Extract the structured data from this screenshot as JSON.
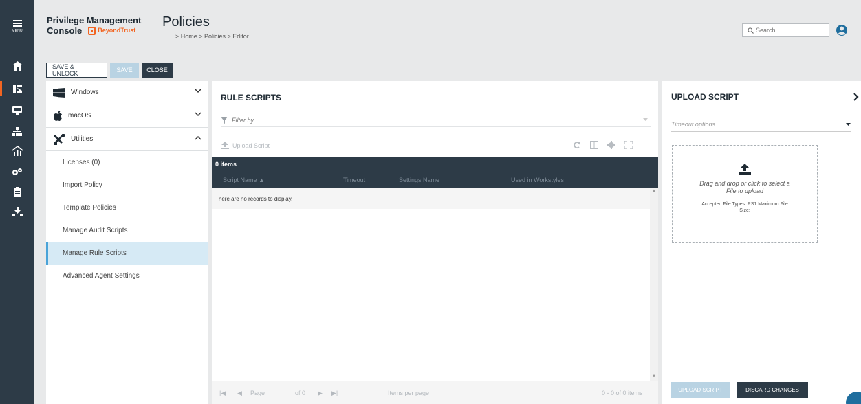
{
  "nav": {
    "menu_label": "MENU",
    "icons": [
      "home-icon",
      "policy-icon",
      "computers-icon",
      "hierarchy-icon",
      "analytics-icon",
      "settings-icon",
      "clipboard-icon",
      "download-icon"
    ],
    "active_index": 1
  },
  "header": {
    "product_line1": "Privilege Management",
    "product_line2": "Console",
    "brand": "BeyondTrust",
    "title": "Policies",
    "breadcrumb": "> Home > Policies > Editor",
    "search_placeholder": "Search"
  },
  "toolbar": {
    "save_unlock": "SAVE & UNLOCK",
    "save": "SAVE",
    "close": "CLOSE"
  },
  "sidebar": {
    "groups": [
      {
        "label": "Windows",
        "icon": "windows-icon",
        "expanded": false
      },
      {
        "label": "macOS",
        "icon": "apple-icon",
        "expanded": false
      },
      {
        "label": "Utilities",
        "icon": "tools-icon",
        "expanded": true
      }
    ],
    "items": [
      {
        "label": "Licenses (0)"
      },
      {
        "label": "Import Policy"
      },
      {
        "label": "Template Policies"
      },
      {
        "label": "Manage Audit Scripts"
      },
      {
        "label": "Manage Rule Scripts"
      },
      {
        "label": "Advanced Agent Settings"
      }
    ],
    "selected_item": 4
  },
  "main": {
    "title": "RULE SCRIPTS",
    "filter_placeholder": "Filter by",
    "upload_link": "Upload Script",
    "count": "0 items",
    "columns": [
      "Script Name ▲",
      "Timeout",
      "Settings Name",
      "Used in Workstyles"
    ],
    "empty": "There are no records to display.",
    "pager": {
      "page_label": "Page",
      "of": "of 0",
      "per_page": "Items per page",
      "summary": "0 - 0 of 0 items"
    }
  },
  "upload": {
    "title": "UPLOAD SCRIPT",
    "timeout_placeholder": "Timeout options",
    "drop_msg": "Drag and drop or click to select a File to upload",
    "accepted": "Accepted File Types: PS1 Maximum File Size:",
    "upload_btn": "UPLOAD SCRIPT",
    "discard_btn": "DISCARD CHANGES"
  },
  "colors": {
    "nav_bg": "#2d3b47",
    "accent": "#f26522",
    "selected_bg": "#d6eaf5",
    "disabled_btn": "#b9d3e3"
  }
}
